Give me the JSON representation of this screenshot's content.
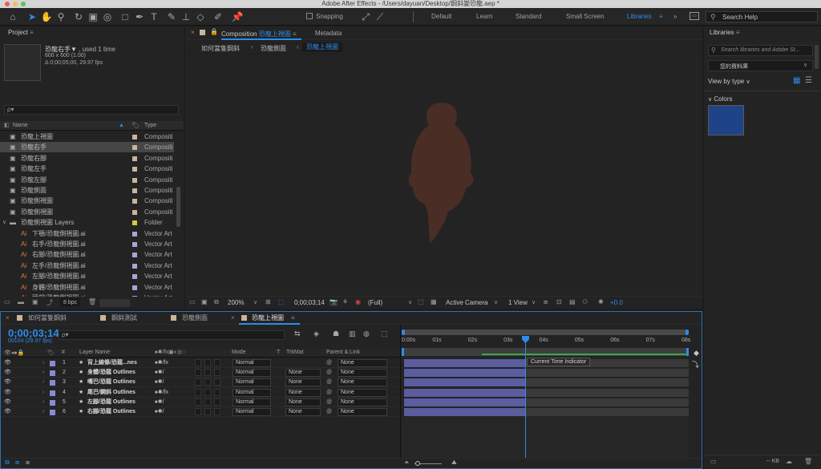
{
  "window": {
    "title": "Adobe After Effects - /Users/dayuan/Desktop/鋼斜變恐龍.aep *"
  },
  "toolbar": {
    "snapping": "Snapping",
    "workspaces": [
      "Default",
      "Learn",
      "Standard",
      "Small Screen",
      "Libraries"
    ],
    "active_workspace": "Libraries",
    "search_placeholder": "Search Help"
  },
  "project": {
    "title": "Project",
    "selected_name": "恐龍右手▼",
    "used": ", used 1 time",
    "size": "600 x 600 (1.00)",
    "duration": "Δ 0;00;05;00, 29.97 fps",
    "search_placeholder": "ρ▾",
    "col_name": "Name",
    "col_type": "Type",
    "items": [
      {
        "name": "恐龍上視圖",
        "type": "Compositi",
        "color": "#c9b59a"
      },
      {
        "name": "恐龍右手",
        "type": "Compositi",
        "color": "#c9b59a"
      },
      {
        "name": "恐龍右腳",
        "type": "Compositi",
        "color": "#c9b59a"
      },
      {
        "name": "恐龍左手",
        "type": "Compositi",
        "color": "#c9b59a"
      },
      {
        "name": "恐龍左腳",
        "type": "Compositi",
        "color": "#c9b59a"
      },
      {
        "name": "恐龍側面",
        "type": "Compositi",
        "color": "#c9b59a"
      },
      {
        "name": "恐龍側視圖",
        "type": "Compositi",
        "color": "#c9b59a"
      },
      {
        "name": "恐龍側視圖",
        "type": "Compositi",
        "color": "#c9b59a"
      },
      {
        "name": "恐龍側視圖 Layers",
        "type": "Folder",
        "color": "#d9c64a"
      },
      {
        "name": "下顎/恐龍側視圖.ai",
        "type": "Vector Art",
        "color": "#a9a6d6"
      },
      {
        "name": "右手/恐龍側視圖.ai",
        "type": "Vector Art",
        "color": "#a9a6d6"
      },
      {
        "name": "右腳/恐龍側視圖.ai",
        "type": "Vector Art",
        "color": "#a9a6d6"
      },
      {
        "name": "左手/恐龍側視圖.ai",
        "type": "Vector Art",
        "color": "#a9a6d6"
      },
      {
        "name": "左腳/恐龍側視圖.ai",
        "type": "Vector Art",
        "color": "#a9a6d6"
      },
      {
        "name": "身體/恐龍側視圖.ai",
        "type": "Vector Art",
        "color": "#a9a6d6"
      },
      {
        "name": "頭部/恐龍側視圖.ai",
        "type": "Vector Art",
        "color": "#a9a6d6"
      }
    ],
    "bpc": "8 bpc"
  },
  "composition": {
    "panel_tab": "Composition",
    "comp_name": "恐龍上視圖",
    "metadata_tab": "Metadata",
    "breadcrumbs": [
      "如何當隻鋼斜",
      "恐龍側面",
      "恐龍上視圖"
    ],
    "zoom": "200%",
    "timecode": "0;00;03;14",
    "resolution": "(Full)",
    "camera": "Active Camera",
    "view": "1 View",
    "exposure": "+0.0"
  },
  "libraries": {
    "title": "Libraries",
    "search_placeholder": "Search libraries and Adobe St...",
    "library": "您的資料庫",
    "view_by": "View by type",
    "colors_section": "Colors",
    "swatch_color": "#1e4487",
    "footer_kb": "-- KB"
  },
  "timeline": {
    "tabs": [
      "如何當隻鋼斜",
      "鋼斜測試",
      "恐龍側面",
      "恐龍上視圖"
    ],
    "active_tab": "恐龍上視圖",
    "current_time": "0;00;03;14",
    "frame_info": "00104 (29.97 fps)",
    "search_placeholder": "ρ▾",
    "headers": {
      "num": "#",
      "name": "Layer Name",
      "mode": "Mode",
      "t": "T",
      "trkmat": "TrkMat",
      "parent": "Parent & Link"
    },
    "ruler": [
      "0:00s",
      "01s",
      "02s",
      "03s",
      "04s",
      "05s",
      "06s",
      "07s",
      "08s"
    ],
    "tooltip": "Current Time Indicator",
    "playhead_sec": 3.47,
    "duration_sec": 8,
    "layers": [
      {
        "num": "1",
        "name": "背上線條/恐龍...nes",
        "mode": "Normal",
        "trkmat": "",
        "parent": "None",
        "fx": true
      },
      {
        "num": "2",
        "name": "身體/恐龍 Outlines",
        "mode": "Normal",
        "trkmat": "None",
        "parent": "None",
        "fx": false
      },
      {
        "num": "3",
        "name": "嘴巴/恐龍 Outlines",
        "mode": "Normal",
        "trkmat": "None",
        "parent": "None",
        "fx": false
      },
      {
        "num": "4",
        "name": "尾巴/鋼斜 Outlines",
        "mode": "Normal",
        "trkmat": "None",
        "parent": "None",
        "fx": true
      },
      {
        "num": "5",
        "name": "左腳/恐龍 Outlines",
        "mode": "Normal",
        "trkmat": "None",
        "parent": "None",
        "fx": false
      },
      {
        "num": "6",
        "name": "右腳/恐龍 Outlines",
        "mode": "Normal",
        "trkmat": "None",
        "parent": "None",
        "fx": false
      }
    ]
  }
}
